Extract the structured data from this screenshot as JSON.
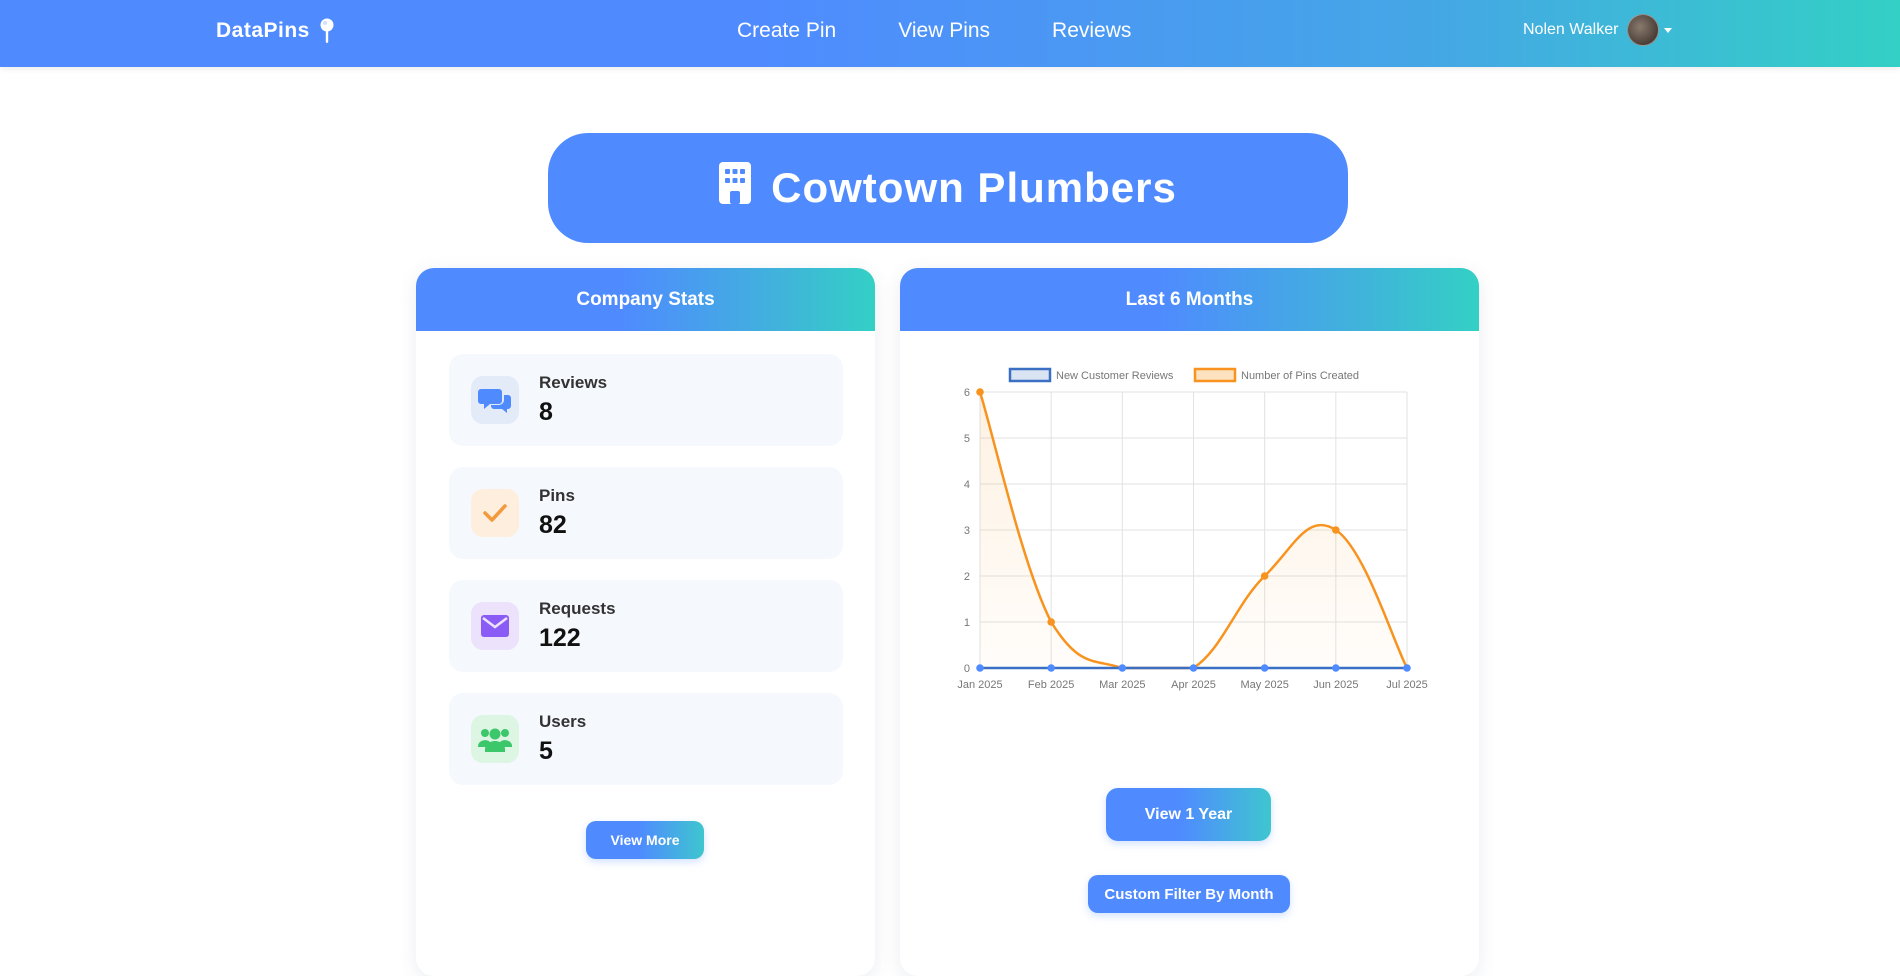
{
  "nav": {
    "brand": "DataPins",
    "links": [
      "Create Pin",
      "View Pins",
      "Reviews"
    ],
    "user_name": "Nolen Walker"
  },
  "company": {
    "name": "Cowtown Plumbers"
  },
  "stats_card": {
    "title": "Company Stats",
    "items": [
      {
        "label": "Reviews",
        "value": "8",
        "icon": "comments-icon",
        "color": "#4f8bff",
        "bg": "#e3ebf9"
      },
      {
        "label": "Pins",
        "value": "82",
        "icon": "check-icon",
        "color": "#f39a3c",
        "bg": "#fdeedd"
      },
      {
        "label": "Requests",
        "value": "122",
        "icon": "envelope-icon",
        "color": "#8a5cf5",
        "bg": "#ece2fb"
      },
      {
        "label": "Users",
        "value": "5",
        "icon": "users-icon",
        "color": "#3cc76a",
        "bg": "#ddf5e3"
      }
    ],
    "view_more": "View More"
  },
  "chart_card": {
    "title": "Last 6 Months",
    "view_year": "View 1 Year",
    "custom_filter": "Custom Filter By Month"
  },
  "chart_data": {
    "type": "line",
    "categories": [
      "Jan 2025",
      "Feb 2025",
      "Mar 2025",
      "Apr 2025",
      "May 2025",
      "Jun 2025",
      "Jul 2025"
    ],
    "series": [
      {
        "name": "New Customer Reviews",
        "values": [
          0,
          0,
          0,
          0,
          0,
          0,
          0
        ],
        "color": "#3a6fc4"
      },
      {
        "name": "Number of Pins Created",
        "values": [
          6,
          1,
          0,
          0,
          2,
          3,
          0
        ],
        "color": "#f7931e"
      }
    ],
    "ylim": [
      0,
      6
    ],
    "yticks": [
      "0",
      "1",
      "2",
      "3",
      "4",
      "5",
      "6"
    ],
    "grid": true,
    "legend": "top"
  }
}
